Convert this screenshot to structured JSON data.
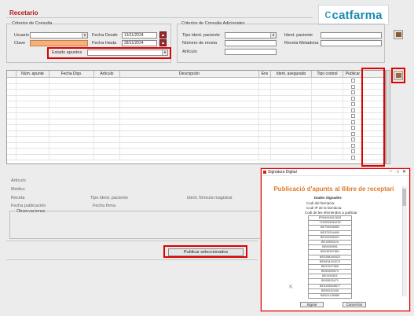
{
  "window": {
    "title": "Recetario"
  },
  "logo": {
    "text_c": "c",
    "text_rest": "catfarma"
  },
  "criteria": {
    "group_label": "Criterios de Consulta",
    "usuario_label": "Usuario",
    "clave_label": "Clave",
    "estado_label": "Estado apuntes",
    "fecha_desde_label": "Fecha Desde",
    "fecha_desde_value": "13/11/2024",
    "fecha_hasta_label": "Fecha Hasta",
    "fecha_hasta_value": "28/11/2024"
  },
  "criteria_extra": {
    "group_label": "Criterios de Consulta Adicionales",
    "tipo_ident_label": "Tipo ident. paciente",
    "numero_receta_label": "Número de receta",
    "articulo_label": "Artículo",
    "ident_paciente_label": "Ident. paciente",
    "receta_metadona_label": "Receta Metadona"
  },
  "grid": {
    "columns": [
      "Núm. apunte",
      "Fecha Disp.",
      "Artículo",
      "Descripción",
      "Env",
      "Ident. asegurado",
      "Tipo control",
      "Publicar"
    ]
  },
  "details": {
    "articulo": "Artículo",
    "medico": "Médico",
    "receta": "Receta",
    "tipo_ident_paciente": "Tipo ident. paciente",
    "ident_formula": "Ident. fórmula magistral",
    "fecha_publicacion": "Fecha publicación",
    "fecha_firma": "Fecha firma",
    "observaciones": "Observaciones"
  },
  "buttons": {
    "publicar": "Publicar seleccionados"
  },
  "popup": {
    "title": "Signatura Digital",
    "heading": "Publicació d'apunts al llibre de receptari",
    "subheading": "Dades Signades",
    "line1": "Codi del farmàcia:",
    "line2": "Codi IP de la farmàcia:",
    "table_header": "Codi de les efemèrides a publicar",
    "codes": [
      "ER54934512833",
      "7155934254232",
      "BE794595653",
      "BE375294990",
      "BE193355021",
      "BE10983124",
      "BE0059591",
      "BE045397851",
      "BE0288180522",
      "BE6534153274",
      "BE21027569",
      "BE59395574",
      "BE1934521",
      "BE05533471",
      "BE4193526677",
      "BE90232345",
      "BE624135856"
    ],
    "sign_button": "Signar",
    "cancel_button": "Cancel·lar"
  }
}
